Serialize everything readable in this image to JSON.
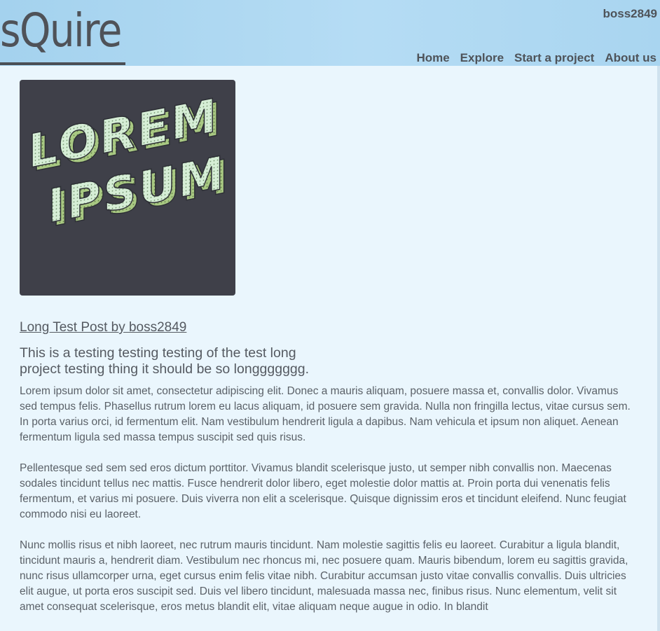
{
  "header": {
    "logo_text": "sQuire",
    "username": "boss2849",
    "nav": [
      "Home",
      "Explore",
      "Start a project",
      "About us"
    ]
  },
  "post": {
    "image_text": [
      "LOREM",
      "IPSUM"
    ],
    "title_link": "Long Test Post by boss2849",
    "subtitle": "This is a testing testing testing of the test long project testing thing it should be so longgggggg.",
    "paragraphs": [
      "Lorem ipsum dolor sit amet, consectetur adipiscing elit. Donec a mauris aliquam, posuere massa et, convallis dolor. Vivamus sed tempus felis. Phasellus rutrum lorem eu lacus aliquam, id posuere sem gravida. Nulla non fringilla lectus, vitae cursus sem. In porta varius orci, id fermentum elit. Nam vestibulum hendrerit ligula a dapibus. Nam vehicula et ipsum non aliquet. Aenean fermentum ligula sed massa tempus suscipit sed quis risus.",
      "Pellentesque sed sem sed eros dictum porttitor. Vivamus blandit scelerisque justo, ut semper nibh convallis non. Maecenas sodales tincidunt tellus nec mattis. Fusce hendrerit dolor libero, eget molestie dolor mattis at. Proin porta dui venenatis felis fermentum, et varius mi posuere. Duis viverra non elit a scelerisque. Quisque dignissim eros et tincidunt eleifend. Nunc feugiat commodo nisi eu laoreet.",
      "Nunc mollis risus et nibh laoreet, nec rutrum mauris tincidunt. Nam molestie sagittis felis eu laoreet. Curabitur a ligula blandit, tincidunt mauris a, hendrerit diam. Vestibulum nec rhoncus mi, nec posuere quam. Mauris bibendum, lorem eu sagittis gravida, nunc risus ullamcorper urna, eget cursus enim felis vitae nibh. Curabitur accumsan justo vitae convallis convallis. Duis ultricies elit augue, ut porta eros suscipit sed. Duis vel libero tincidunt, malesuada massa nec, finibus risus. Nunc elementum, velit sit amet consequat scelerisque, eros metus blandit elit, vitae aliquam neque augue in odio. In blandit"
    ]
  },
  "colors": {
    "header_bg": "#a9d5f0",
    "page_bg": "#eaf6fd",
    "text": "#555a61",
    "image_bg": "#3f4049",
    "letter_face": "#d6eed6",
    "letter_side": "#a9c983"
  }
}
